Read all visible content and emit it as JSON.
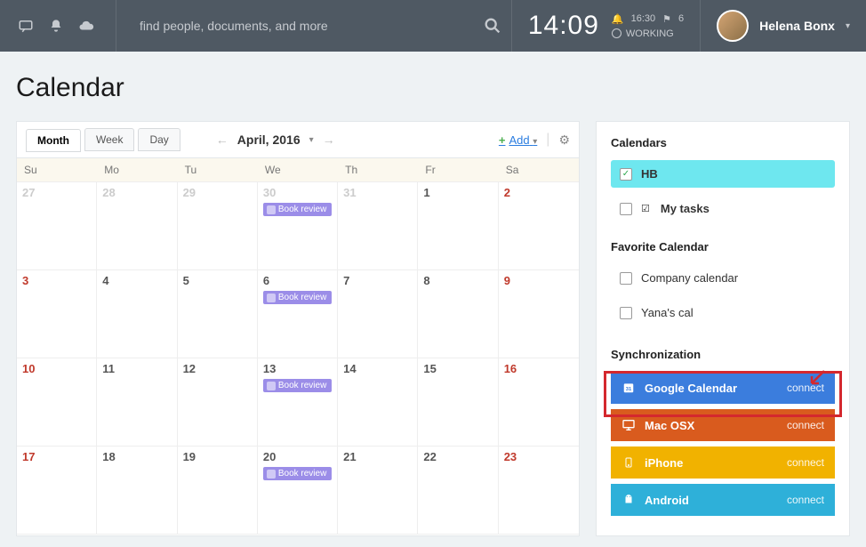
{
  "topbar": {
    "search_placeholder": "find people, documents, and more",
    "clock_time": "14:09",
    "bell_time": "16:30",
    "flag_count": "6",
    "status": "WORKING",
    "user_name": "Helena Bonx"
  },
  "page": {
    "title": "Calendar"
  },
  "tabs": {
    "month": "Month",
    "week": "Week",
    "day": "Day"
  },
  "month_label": "April, 2016",
  "add_label": "Add",
  "weekdays": [
    "Su",
    "Mo",
    "Tu",
    "We",
    "Th",
    "Fr",
    "Sa"
  ],
  "event_label": "Book review",
  "cells": [
    {
      "n": "27",
      "cls": "other"
    },
    {
      "n": "28",
      "cls": "other"
    },
    {
      "n": "29",
      "cls": "other"
    },
    {
      "n": "30",
      "cls": "other",
      "ev": true
    },
    {
      "n": "31",
      "cls": "other"
    },
    {
      "n": "1",
      "cls": ""
    },
    {
      "n": "2",
      "cls": "weekend"
    },
    {
      "n": "3",
      "cls": "weekend"
    },
    {
      "n": "4",
      "cls": ""
    },
    {
      "n": "5",
      "cls": ""
    },
    {
      "n": "6",
      "cls": "",
      "ev": true
    },
    {
      "n": "7",
      "cls": ""
    },
    {
      "n": "8",
      "cls": ""
    },
    {
      "n": "9",
      "cls": "weekend"
    },
    {
      "n": "10",
      "cls": "weekend"
    },
    {
      "n": "11",
      "cls": ""
    },
    {
      "n": "12",
      "cls": ""
    },
    {
      "n": "13",
      "cls": "",
      "ev": true
    },
    {
      "n": "14",
      "cls": ""
    },
    {
      "n": "15",
      "cls": ""
    },
    {
      "n": "16",
      "cls": "weekend"
    },
    {
      "n": "17",
      "cls": "weekend"
    },
    {
      "n": "18",
      "cls": ""
    },
    {
      "n": "19",
      "cls": ""
    },
    {
      "n": "20",
      "cls": "",
      "ev": true
    },
    {
      "n": "21",
      "cls": ""
    },
    {
      "n": "22",
      "cls": ""
    },
    {
      "n": "23",
      "cls": "weekend"
    }
  ],
  "sidebar": {
    "calendars_title": "Calendars",
    "hb_label": "HB",
    "mytasks_label": "My tasks",
    "favorite_title": "Favorite Calendar",
    "company_label": "Company calendar",
    "yana_label": "Yana's cal",
    "sync_title": "Synchronization",
    "connect_label": "connect",
    "google": "Google Calendar",
    "mac": "Mac OSX",
    "iphone": "iPhone",
    "android": "Android"
  }
}
